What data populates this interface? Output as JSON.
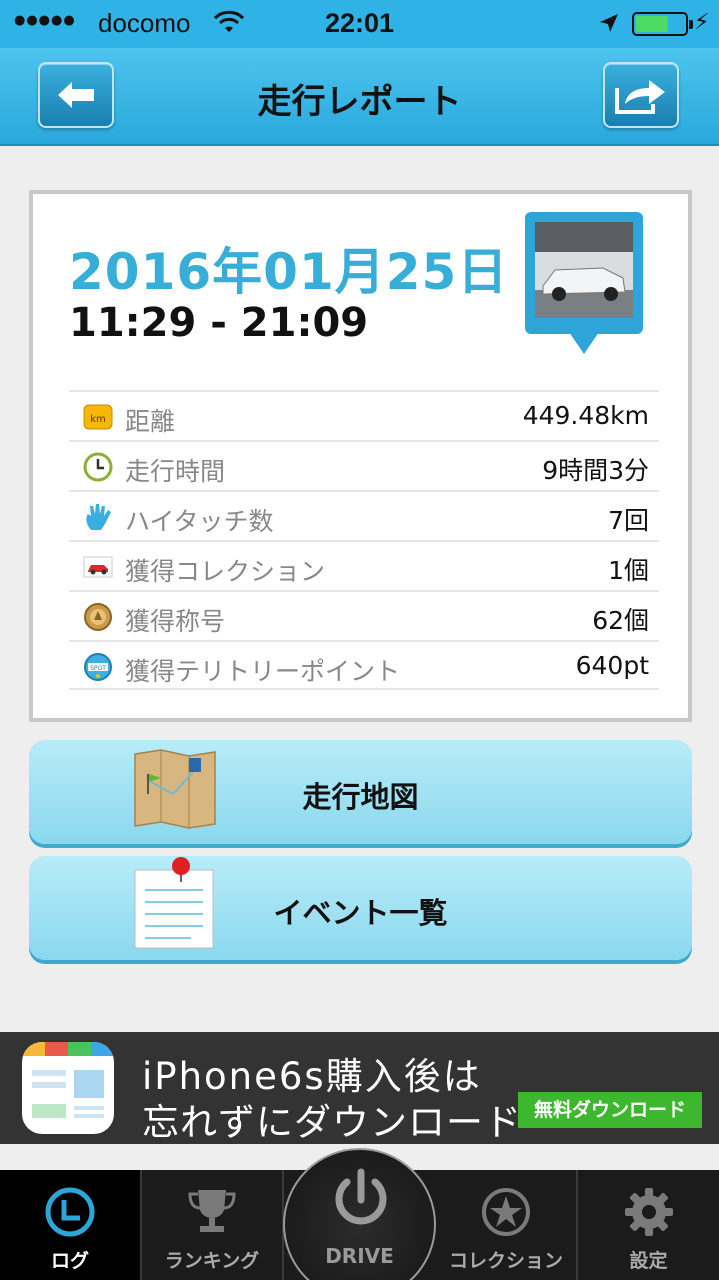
{
  "status_bar": {
    "signal": "●●●●●",
    "carrier": "docomo",
    "time": "22:01"
  },
  "nav": {
    "title": "走行レポート",
    "back_icon": "back-arrow-icon",
    "share_icon": "share-icon"
  },
  "report": {
    "date": "2016年01月25日",
    "time_range": "11:29 - 21:09",
    "stats": [
      {
        "icon": "km-icon",
        "label": "距離",
        "value": "449.48km"
      },
      {
        "icon": "clock-icon",
        "label": "走行時間",
        "value": "9時間3分"
      },
      {
        "icon": "hi-touch-icon",
        "label": "ハイタッチ数",
        "value": "7回"
      },
      {
        "icon": "car-collection-icon",
        "label": "獲得コレクション",
        "value": "1個"
      },
      {
        "icon": "medal-icon",
        "label": "獲得称号",
        "value": "62個"
      },
      {
        "icon": "spot-icon",
        "label": "獲得テリトリーポイント",
        "value": "640pt"
      }
    ]
  },
  "buttons": {
    "map": "走行地図",
    "events": "イベント一覧"
  },
  "ad": {
    "line1": "iPhone6s購入後は",
    "line2": "忘れずにダウンロード",
    "download": "無料ダウンロード"
  },
  "tabs": {
    "log": "ログ",
    "ranking": "ランキング",
    "drive": "DRIVE",
    "collection": "コレクション",
    "settings": "設定",
    "active": "log"
  },
  "colors": {
    "header": "#2fb2e6",
    "date_accent": "#37aed8",
    "button": "#a6e4f4",
    "ad_button": "#3cb72e"
  }
}
